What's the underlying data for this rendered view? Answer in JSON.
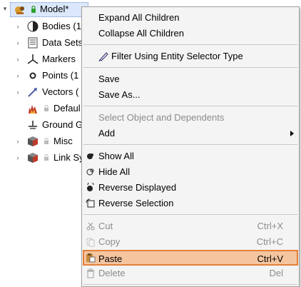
{
  "tree": {
    "root": {
      "label": "Model*"
    },
    "items": [
      {
        "label": "Bodies (1",
        "icon": "sphere-icon"
      },
      {
        "label": "Data Sets",
        "icon": "document-icon"
      },
      {
        "label": "Markers",
        "icon": "marker-icon"
      },
      {
        "label": "Points (1",
        "icon": "point-icon"
      },
      {
        "label": "Vectors (",
        "icon": "vector-icon"
      },
      {
        "label": "Defaul",
        "icon": "flame-icon"
      },
      {
        "label": "Ground G",
        "icon": "ground-icon"
      },
      {
        "label": "Misc",
        "icon": "cube-icon"
      },
      {
        "label": "Link Sy",
        "icon": "cube-icon"
      }
    ]
  },
  "menu": {
    "expand_all": "Expand All Children",
    "collapse_all": "Collapse All Children",
    "filter": "Filter Using Entity Selector Type",
    "save": "Save",
    "save_as": "Save As...",
    "select_object": "Select Object and Dependents",
    "add": "Add",
    "show_all": "Show All",
    "hide_all": "Hide All",
    "reverse_displayed": "Reverse Displayed",
    "reverse_selection": "Reverse Selection",
    "cut": "Cut",
    "cut_shortcut": "Ctrl+X",
    "copy": "Copy",
    "copy_shortcut": "Ctrl+C",
    "paste": "Paste",
    "paste_shortcut": "Ctrl+V",
    "delete": "Delete",
    "delete_shortcut": "Del"
  },
  "colors": {
    "highlight_fill": "#f5c5a0",
    "highlight_border": "#e4803a",
    "selection": "#dbe8fb"
  }
}
